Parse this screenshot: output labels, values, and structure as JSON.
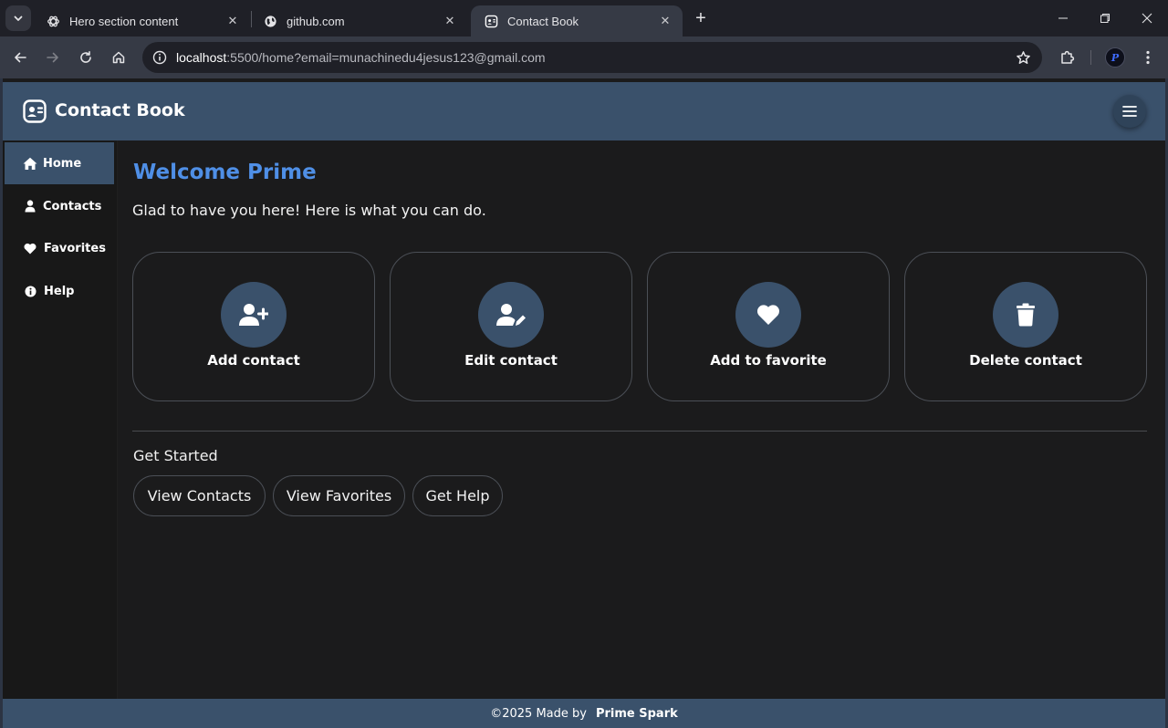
{
  "browser": {
    "tabs": [
      {
        "label": "Hero section content",
        "favicon": "openai-icon"
      },
      {
        "label": "github.com",
        "favicon": "globe-icon"
      },
      {
        "label": "Contact Book",
        "favicon": "contact-book-icon",
        "active": true
      }
    ],
    "url_host": "localhost",
    "url_path": ":5500/home?email=munachinedu4jesus123@gmail.com",
    "profile_initial": "P"
  },
  "app": {
    "brand": "Contact Book",
    "accent": "#3a516b",
    "sidebar": {
      "items": [
        {
          "label": "Home",
          "icon": "home-icon",
          "active": true
        },
        {
          "label": "Contacts",
          "icon": "user-icon"
        },
        {
          "label": "Favorites",
          "icon": "heart-icon"
        },
        {
          "label": "Help",
          "icon": "info-icon"
        }
      ]
    },
    "main": {
      "welcome": "Welcome Prime",
      "subtitle": "Glad to have you here! Here is what you can do.",
      "cards": [
        {
          "label": "Add contact",
          "icon": "user-plus-icon"
        },
        {
          "label": "Edit contact",
          "icon": "user-edit-icon"
        },
        {
          "label": "Add to favorite",
          "icon": "heart-icon"
        },
        {
          "label": "Delete contact",
          "icon": "trash-icon"
        }
      ],
      "get_started_title": "Get Started",
      "buttons": [
        "View Contacts",
        "View Favorites",
        "Get Help"
      ]
    },
    "footer": {
      "text": "©2025 Made by",
      "author": "Prime Spark"
    }
  }
}
